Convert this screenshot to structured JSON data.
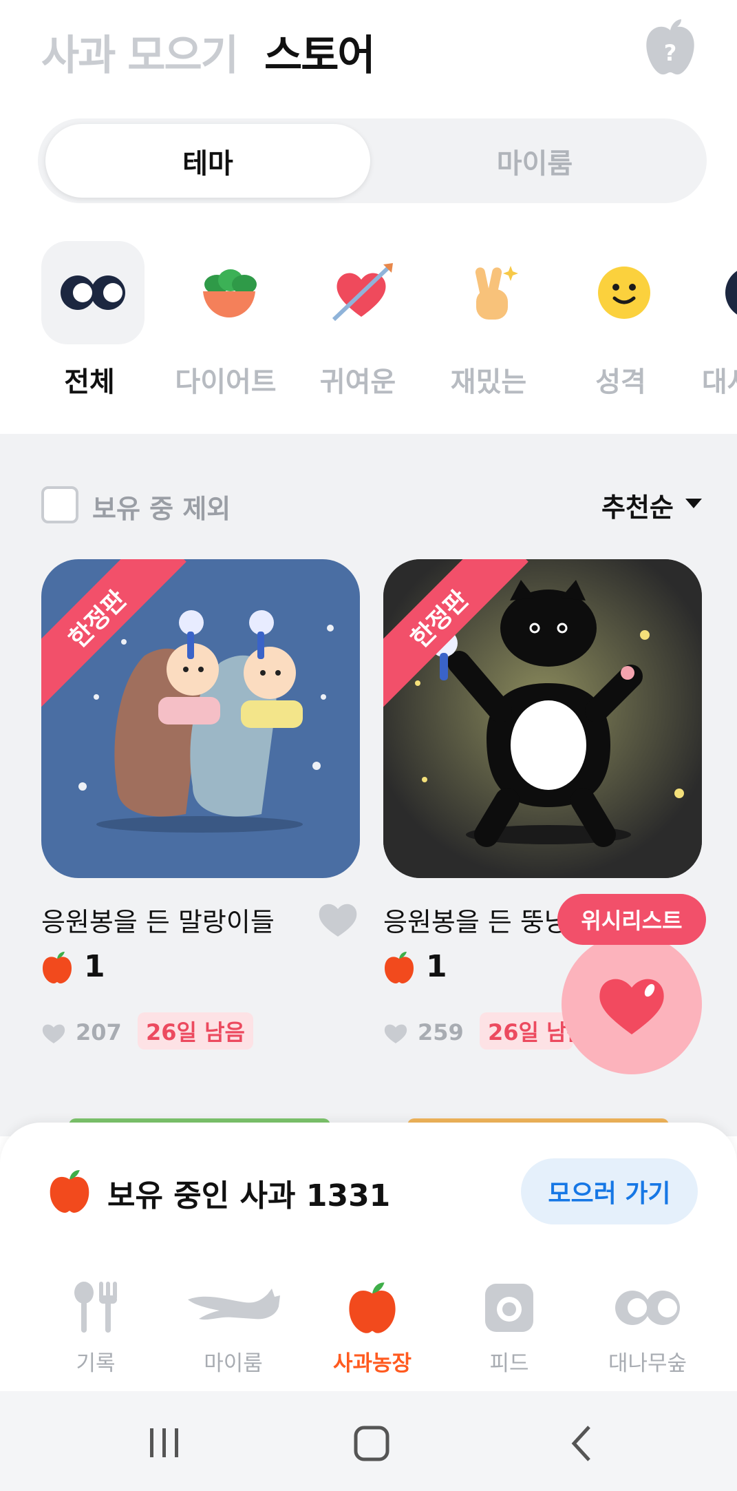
{
  "header": {
    "tab_collect": "사과 모으기",
    "tab_store": "스토어"
  },
  "segment": {
    "active": "테마",
    "inactive": "마이룸"
  },
  "categories": [
    {
      "label": "전체",
      "icon": "eyes-icon",
      "active": true
    },
    {
      "label": "다이어트",
      "icon": "salad-bowl-icon"
    },
    {
      "label": "귀여운",
      "icon": "heart-arrow-icon"
    },
    {
      "label": "재밌는",
      "icon": "victory-hand-icon"
    },
    {
      "label": "성격",
      "icon": "smiley-icon"
    },
    {
      "label": "대사",
      "icon": "partial-icon"
    }
  ],
  "filter": {
    "exclude_owned": "보유 중 제외",
    "sort": "추천순",
    "exclude_checked": false
  },
  "products": [
    {
      "ribbon": "한정판",
      "title": "응원봉을 든 말랑이들",
      "price": "1",
      "likes": "207",
      "badge": "26일 남음",
      "bg": "#4a6ea3"
    },
    {
      "ribbon": "한정판",
      "title": "응원봉을 든 뚱냥",
      "price": "1",
      "likes": "259",
      "badge": "26일 남음",
      "bg": "#2b2b2b"
    }
  ],
  "wishlist": {
    "label": "위시리스트"
  },
  "owned": {
    "text": "보유 중인 사과 1331",
    "button": "모으러 가기"
  },
  "nav": [
    {
      "label": "기록",
      "icon": "fork-spoon-icon"
    },
    {
      "label": "마이룸",
      "icon": "cat-icon"
    },
    {
      "label": "사과농장",
      "icon": "apple-icon",
      "active": true
    },
    {
      "label": "피드",
      "icon": "camera-icon"
    },
    {
      "label": "대나무숲",
      "icon": "eyes-icon"
    }
  ],
  "colors": {
    "accent": "#ff5a1f",
    "pink": "#f2506a",
    "blue": "#1677e5"
  }
}
